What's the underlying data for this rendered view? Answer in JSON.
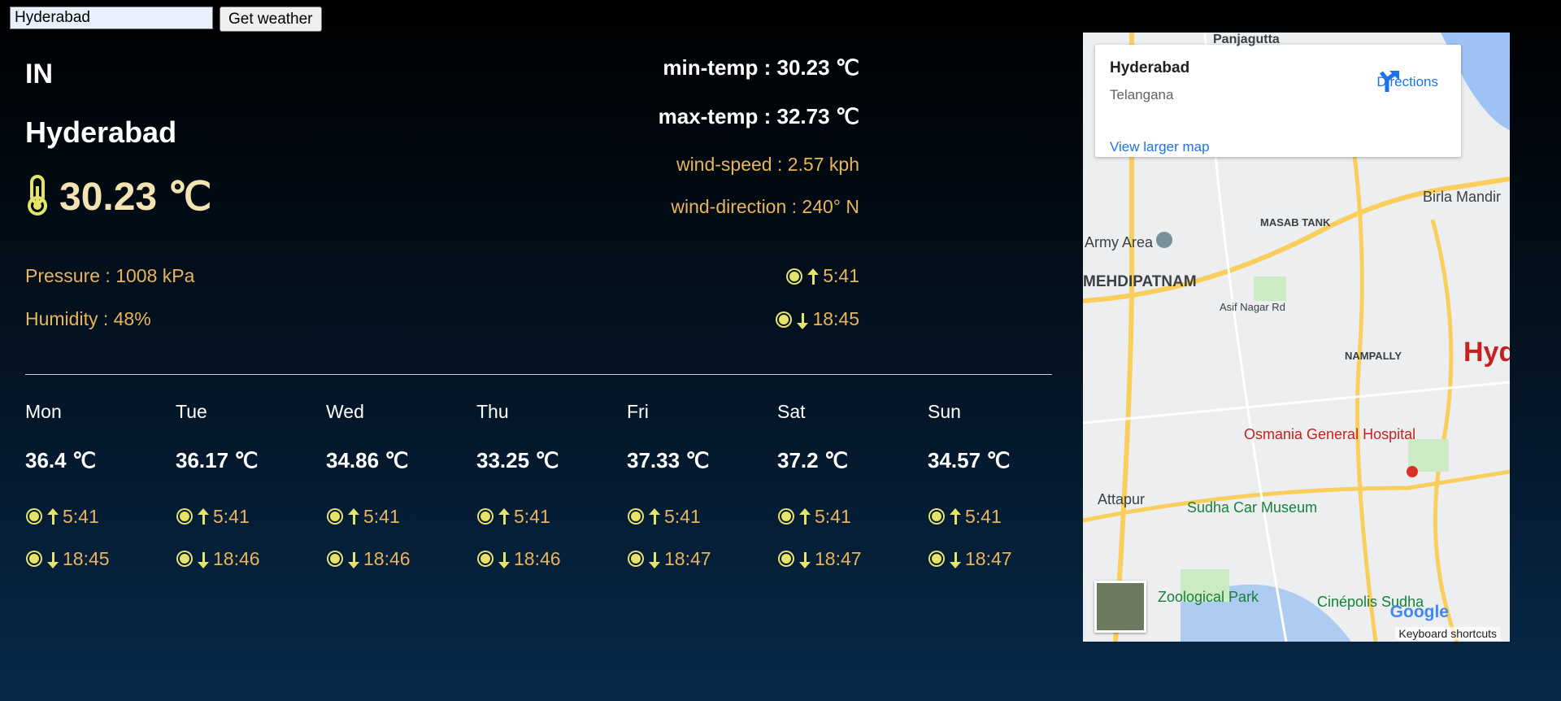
{
  "search": {
    "value": "Hyderabad",
    "button_label": "Get weather"
  },
  "current": {
    "country": "IN",
    "city": "Hyderabad",
    "temp": "30.23 ℃",
    "pressure": "Pressure : 1008 kPa",
    "humidity": "Humidity : 48%",
    "min_temp": "min-temp : 30.23 ℃",
    "max_temp": "max-temp : 32.73 ℃",
    "wind_speed": "wind-speed : 2.57 kph",
    "wind_direction": "wind-direction : 240° N",
    "sunrise": "5:41",
    "sunset": "18:45"
  },
  "forecast": [
    {
      "day": "Mon",
      "temp": "36.4 ℃",
      "sunrise": "5:41",
      "sunset": "18:45"
    },
    {
      "day": "Tue",
      "temp": "36.17 ℃",
      "sunrise": "5:41",
      "sunset": "18:46"
    },
    {
      "day": "Wed",
      "temp": "34.86 ℃",
      "sunrise": "5:41",
      "sunset": "18:46"
    },
    {
      "day": "Thu",
      "temp": "33.25 ℃",
      "sunrise": "5:41",
      "sunset": "18:46"
    },
    {
      "day": "Fri",
      "temp": "37.33 ℃",
      "sunrise": "5:41",
      "sunset": "18:47"
    },
    {
      "day": "Sat",
      "temp": "37.2 ℃",
      "sunrise": "5:41",
      "sunset": "18:47"
    },
    {
      "day": "Sun",
      "temp": "34.57 ℃",
      "sunrise": "5:41",
      "sunset": "18:47"
    }
  ],
  "map": {
    "place_title": "Hyderabad",
    "place_subtitle": "Telangana",
    "directions_label": "Directions",
    "larger_map_link": "View larger map",
    "keyboard_shortcuts": "Keyboard shortcuts",
    "google_logo": "Google",
    "labels": [
      "Panjagutta",
      "MASAB TANK",
      "Birla Mandir",
      "Army Area",
      "MEHDIPATNAM",
      "Asif Nagar Rd",
      "NAMPALLY",
      "Osmania General Hospital",
      "Attapur",
      "Sudha Car Museum",
      "Zoological Park",
      "Cinépolis Sudha",
      "Hyd"
    ]
  },
  "colors": {
    "accent_text": "#e8b55b",
    "icon_yellow": "#e6e36a",
    "temp_text": "#f4e3b2"
  },
  "icons": {
    "thermometer": "thermometer-icon",
    "sun": "sun-icon",
    "arrow_up": "arrow-up-icon",
    "arrow_down": "arrow-down-icon"
  }
}
